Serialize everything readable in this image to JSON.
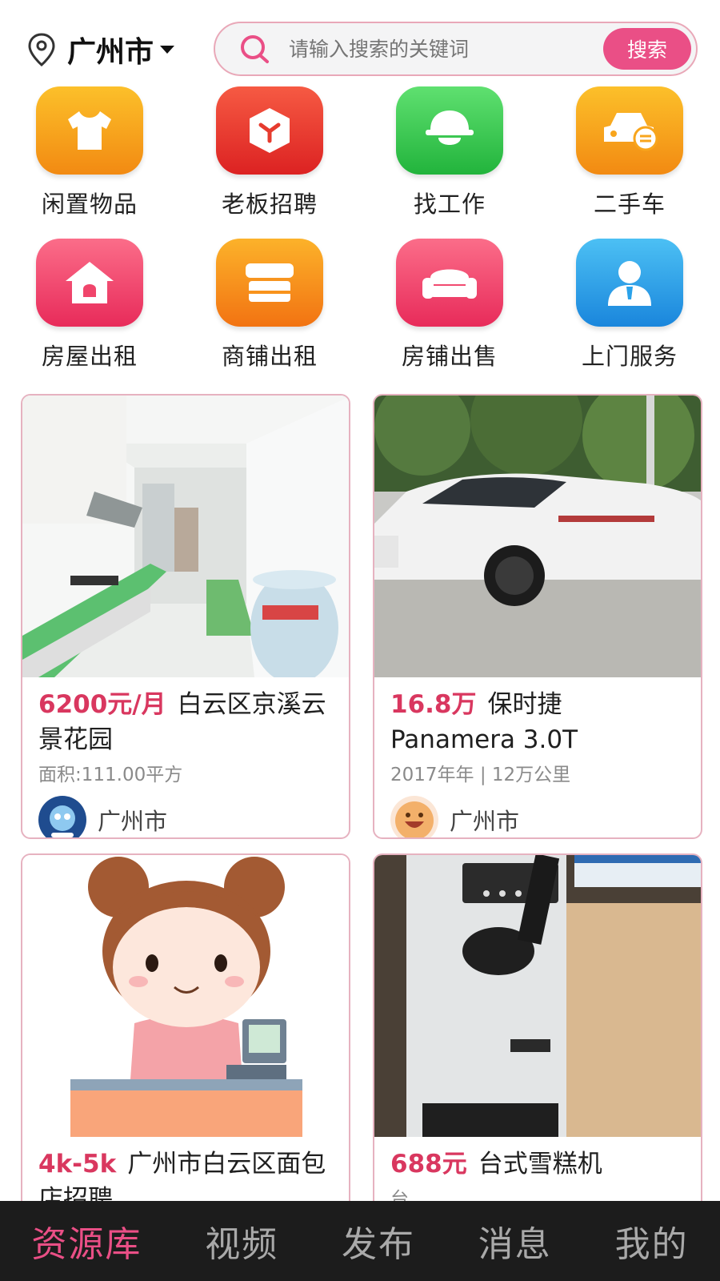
{
  "header": {
    "city": "广州市",
    "search_placeholder": "请输入搜索的关键词",
    "search_button": "搜索"
  },
  "categories": [
    {
      "label": "闲置物品",
      "icon": "tshirt-icon",
      "color": "#f8a51c"
    },
    {
      "label": "老板招聘",
      "icon": "cube-icon",
      "color": "#ee3a2e"
    },
    {
      "label": "找工作",
      "icon": "helmet-icon",
      "color": "#3fce4f"
    },
    {
      "label": "二手车",
      "icon": "car-icon",
      "color": "#f9a01b"
    },
    {
      "label": "房屋出租",
      "icon": "house-icon",
      "color": "#f0456b"
    },
    {
      "label": "商铺出租",
      "icon": "store-icon",
      "color": "#f8931c"
    },
    {
      "label": "房铺出售",
      "icon": "sofa-icon",
      "color": "#f0456b"
    },
    {
      "label": "上门服务",
      "icon": "person-icon",
      "color": "#2aa2ea"
    }
  ],
  "listings": [
    {
      "price": "6200元/月",
      "title": "白云区京溪云景花园",
      "sub": "面积:111.00平方",
      "city": "广州市",
      "image": "kitchen-photo"
    },
    {
      "price": "16.8万",
      "title": "保时捷 Panamera 3.0T",
      "sub": "2017年年 | 12万公里",
      "city": "广州市",
      "image": "white-car-photo"
    },
    {
      "price": "4k-5k",
      "title": "广州市白云区面包店招聘",
      "sub": "",
      "city": "",
      "image": "cashier-cartoon"
    },
    {
      "price": "688元",
      "title": "台式雪糕机",
      "sub": "台",
      "city": "",
      "image": "ice-cream-machine-photo"
    }
  ],
  "nav": [
    {
      "label": "资源库",
      "active": true
    },
    {
      "label": "视频",
      "active": false
    },
    {
      "label": "发布",
      "active": false
    },
    {
      "label": "消息",
      "active": false
    },
    {
      "label": "我的",
      "active": false
    }
  ],
  "colors": {
    "accent": "#ea4f86",
    "price": "#d9375f",
    "card_border": "#e6b2c0",
    "nav_bg": "#1c1c1c"
  }
}
